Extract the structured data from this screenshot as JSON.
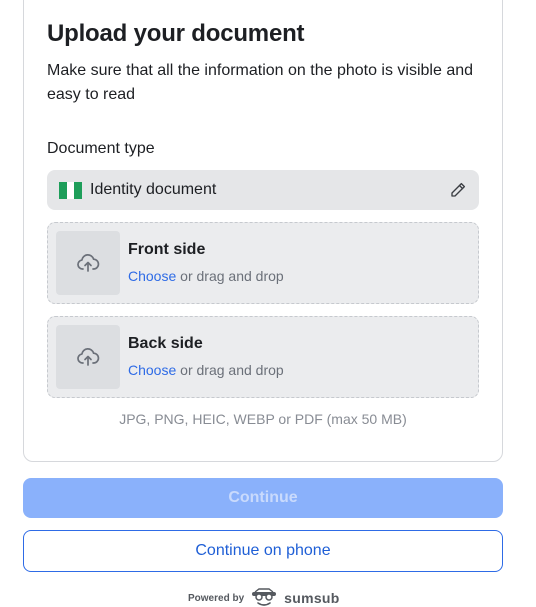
{
  "header": {
    "title": "Upload your document",
    "subtitle": "Make sure that all the information on the photo is visible and easy to read"
  },
  "document_type": {
    "label": "Document type",
    "value": "Identity document",
    "flag_icon": "nigeria-flag-icon",
    "edit_icon": "pencil-icon"
  },
  "uploads": {
    "front": {
      "title": "Front side",
      "choose": "Choose",
      "rest": " or drag and drop",
      "icon": "cloud-upload-icon"
    },
    "back": {
      "title": "Back side",
      "choose": "Choose",
      "rest": " or drag and drop",
      "icon": "cloud-upload-icon"
    }
  },
  "formats_hint": "JPG, PNG, HEIC, WEBP or PDF (max 50 MB)",
  "actions": {
    "continue": "Continue",
    "continue_on_phone": "Continue on phone"
  },
  "footer": {
    "powered_by": "Powered by",
    "brand": "sumsub",
    "brand_icon": "sumsub-logo-icon"
  },
  "colors": {
    "accent": "#2e6be6",
    "continue_disabled": "#8ab1fb",
    "field_bg": "#e5e6e8",
    "flag_green": "#1e9e5a"
  }
}
